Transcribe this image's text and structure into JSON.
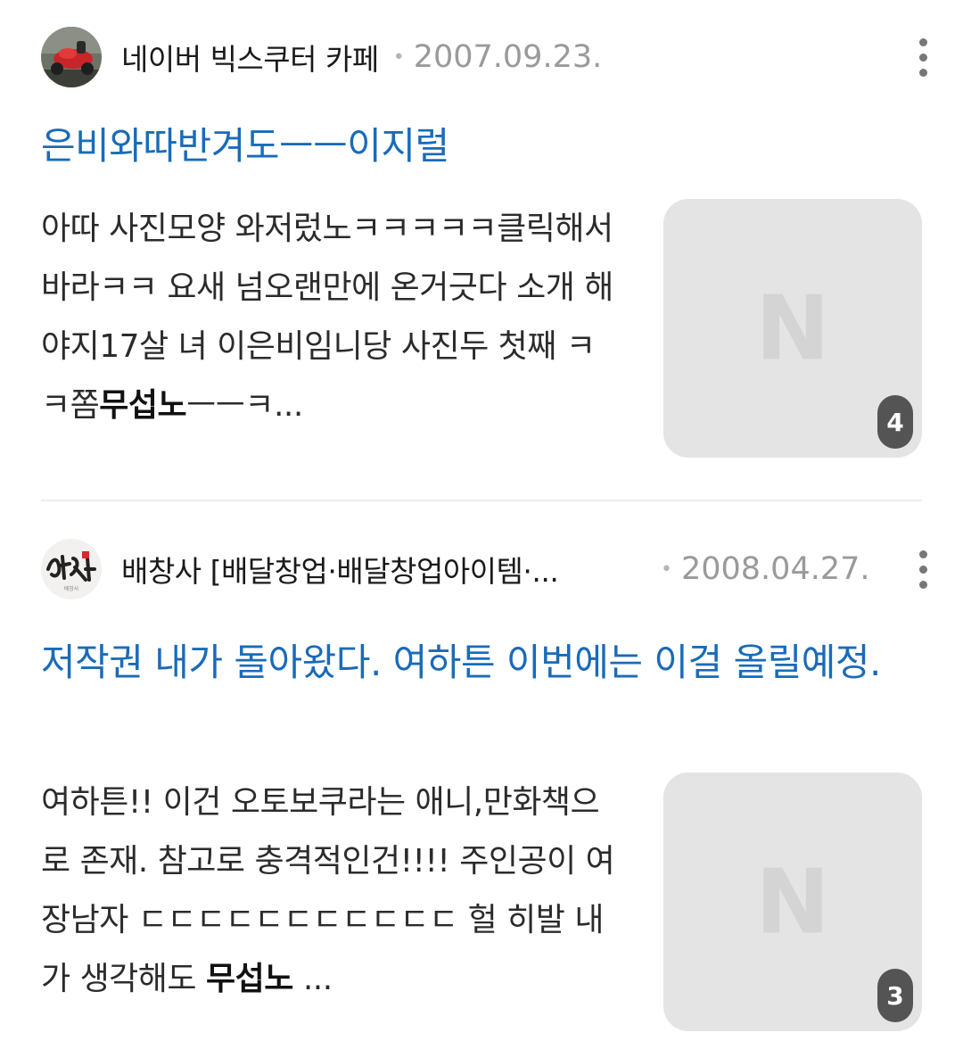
{
  "posts": [
    {
      "cafe_name": "네이버 빅스쿠터 카페",
      "date": "2007.09.23.",
      "title": "은비와따반겨도ㅡㅡ이지럴",
      "snippet_before": "아따 사진모양 와저렀노ㅋㅋㅋㅋㅋ클릭해서바라ㅋㅋ 요새 넘오랜만에 온거긋다 소개 해야지17살 녀 이은비임니당 사진두 첫째 ㅋㅋ쫌",
      "snippet_bold": "무섭노",
      "snippet_after": "ㅡㅡㅋ...",
      "thumb_logo": "N",
      "image_count": "4",
      "avatar_icon": "scooter-avatar-icon"
    },
    {
      "cafe_name": "배창사 [배달창업·배달창업아이템·...",
      "date": "2008.04.27.",
      "title": "저작권 내가 돌아왔다. 여하튼 이번에는 이걸 올릴예정.",
      "snippet_before": "여하튼!! 이건 오토보쿠라는 애니,만화책으로 존재. 참고로 충격적인건!!!! 주인공이 여장남자 ㄷㄷㄷㄷㄷㄷㄷㄷㄷㄷㄷ 헐 히발 내가 생각해도 ",
      "snippet_bold": "무섭노",
      "snippet_after": " ...",
      "thumb_logo": "N",
      "image_count": "3",
      "avatar_icon": "calligraphy-logo-avatar-icon",
      "avatar_logo_text": "배창사"
    }
  ],
  "colors": {
    "title_link": "#1a6bb8",
    "date": "#9a9a9a",
    "thumb_bg": "#e4e4e4",
    "count_badge": "#545454"
  }
}
